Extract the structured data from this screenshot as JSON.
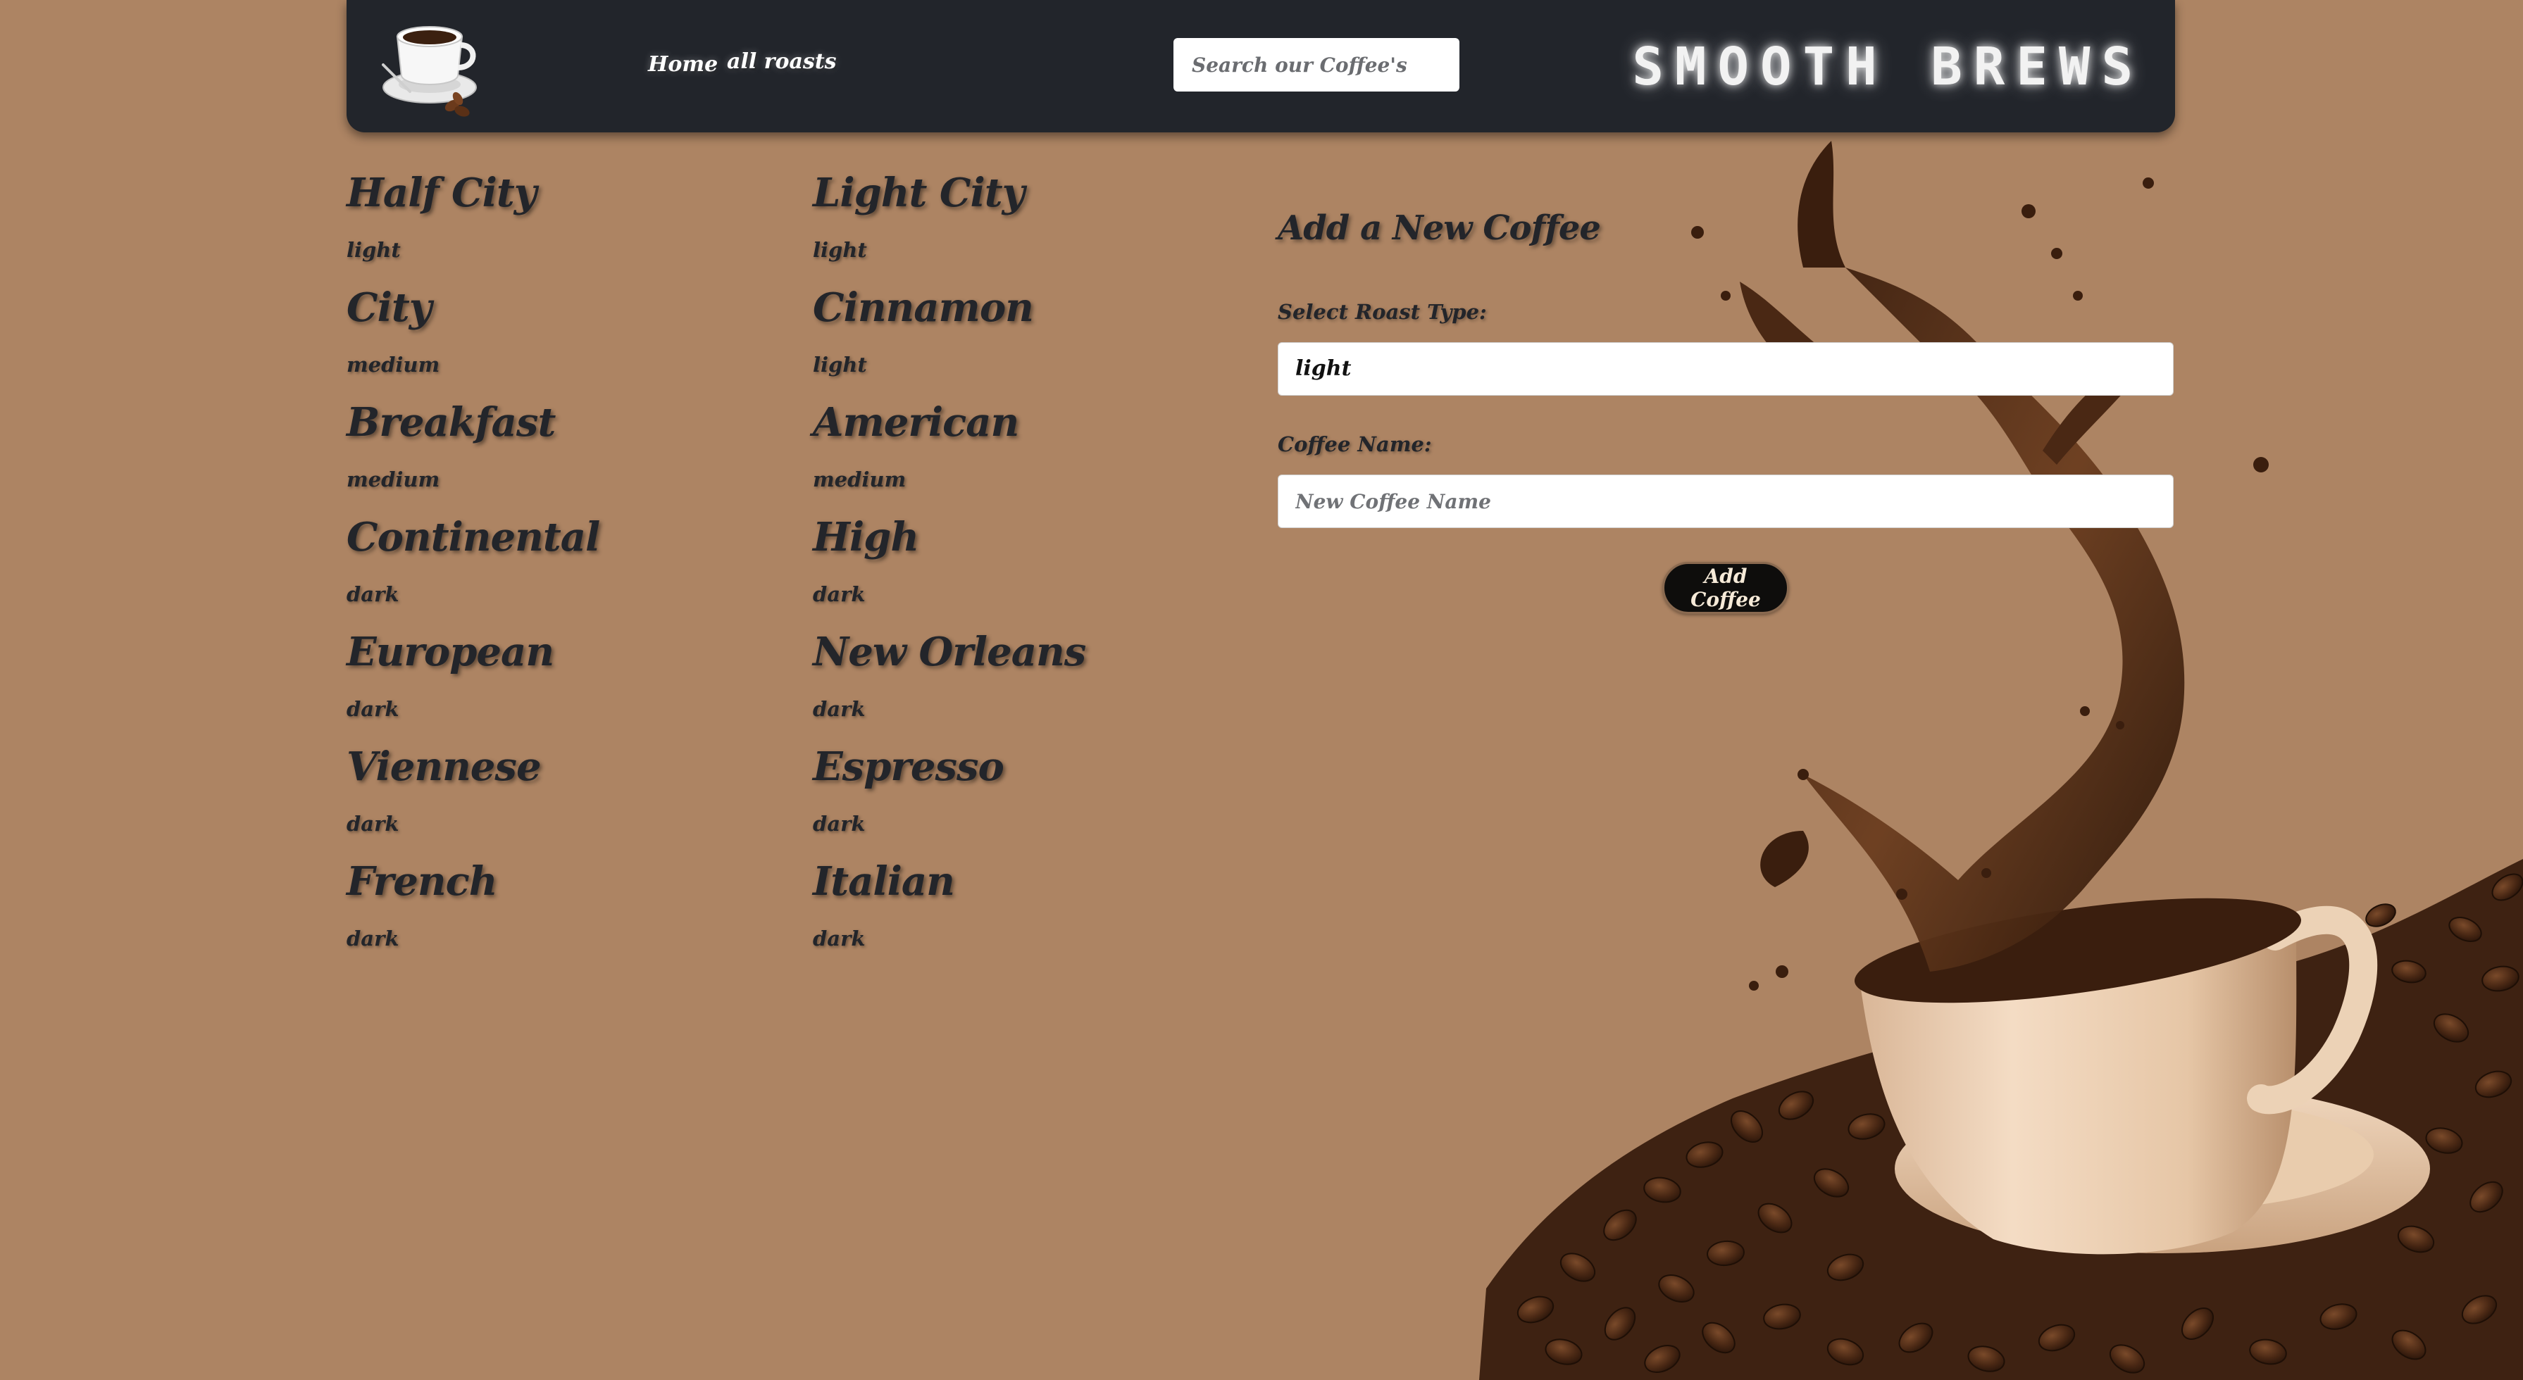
{
  "header": {
    "logo_icon": "coffee-cup-logo",
    "nav": [
      {
        "label": "Home"
      },
      {
        "label": "all roasts"
      }
    ],
    "search_placeholder": "Search our Coffee's",
    "brand": "SMOOTH BREWS"
  },
  "coffees": [
    {
      "name": "Half City",
      "roast": "light"
    },
    {
      "name": "Light City",
      "roast": "light"
    },
    {
      "name": "City",
      "roast": "medium"
    },
    {
      "name": "Cinnamon",
      "roast": "light"
    },
    {
      "name": "Breakfast",
      "roast": "medium"
    },
    {
      "name": "American",
      "roast": "medium"
    },
    {
      "name": "Continental",
      "roast": "dark"
    },
    {
      "name": "High",
      "roast": "dark"
    },
    {
      "name": "European",
      "roast": "dark"
    },
    {
      "name": "New Orleans",
      "roast": "dark"
    },
    {
      "name": "Viennese",
      "roast": "dark"
    },
    {
      "name": "Espresso",
      "roast": "dark"
    },
    {
      "name": "French",
      "roast": "dark"
    },
    {
      "name": "Italian",
      "roast": "dark"
    }
  ],
  "add_form": {
    "title": "Add a New Coffee",
    "roast_label": "Select Roast Type:",
    "roast_selected": "light",
    "name_label": "Coffee Name:",
    "name_placeholder": "New Coffee Name",
    "submit_label": "Add Coffee"
  },
  "colors": {
    "background": "#ad8463",
    "navbar": "#22252b",
    "text": "#23252a",
    "button": "#0e0d0c"
  }
}
